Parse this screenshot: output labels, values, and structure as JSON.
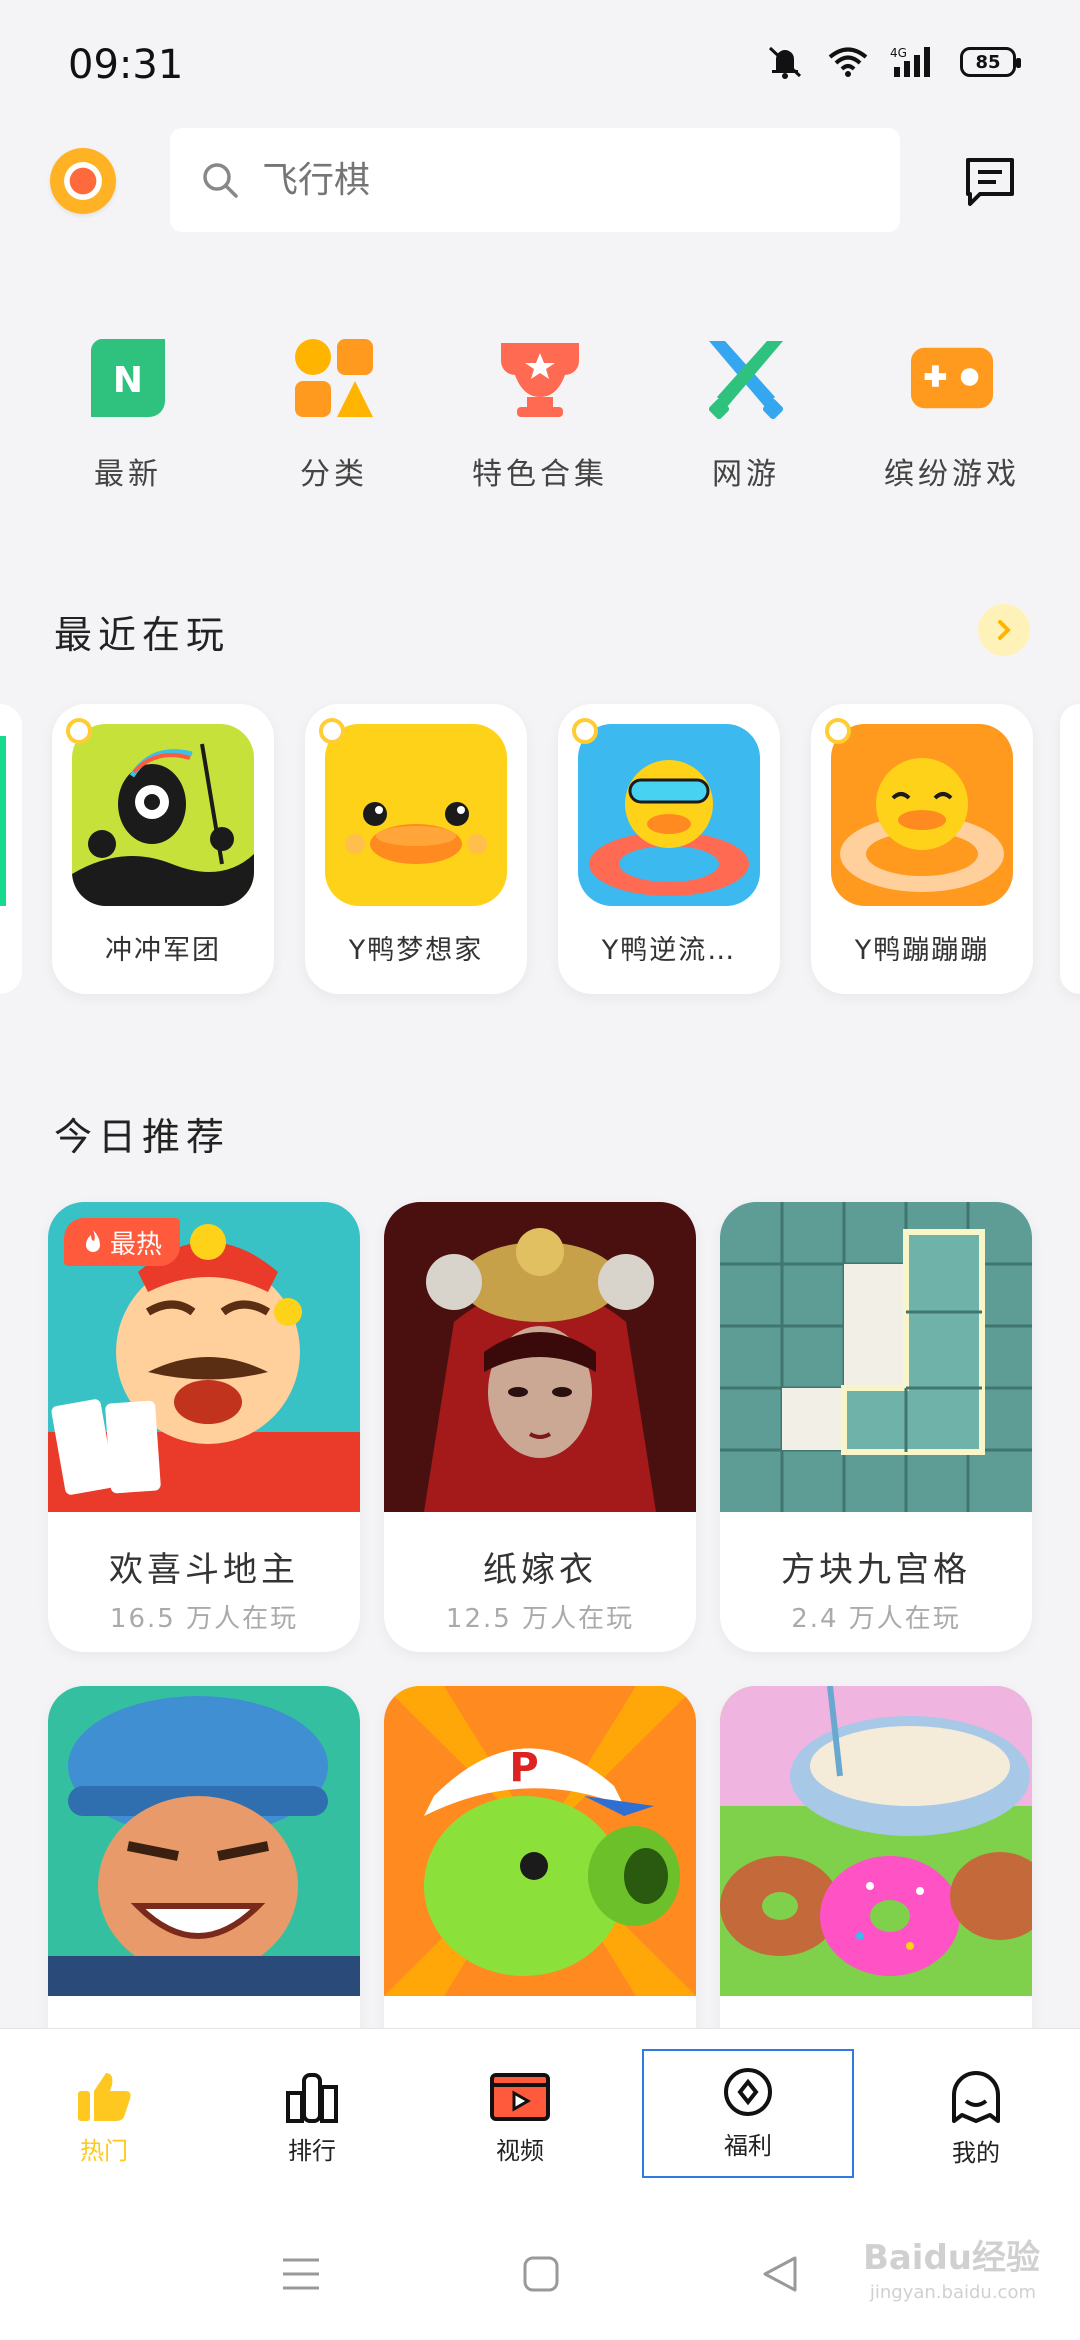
{
  "status_bar": {
    "time": "09:31",
    "battery": "85",
    "network": "4G"
  },
  "search": {
    "placeholder": "飞行棋"
  },
  "categories": [
    {
      "label": "最新",
      "icon": "new-badge-icon",
      "letter": "N"
    },
    {
      "label": "分类",
      "icon": "category-shapes-icon"
    },
    {
      "label": "特色合集",
      "icon": "trophy-icon"
    },
    {
      "label": "网游",
      "icon": "crossed-swords-icon"
    },
    {
      "label": "缤纷游戏",
      "icon": "gamepad-icon"
    }
  ],
  "recent": {
    "title": "最近在玩",
    "items": [
      {
        "name": "冲冲军团"
      },
      {
        "name": "Y鸭梦想家"
      },
      {
        "name": "Y鸭逆流…"
      },
      {
        "name": "Y鸭蹦蹦蹦"
      }
    ]
  },
  "recommend": {
    "title": "今日推荐",
    "hot_tag": "最热",
    "items": [
      {
        "name": "欢喜斗地主",
        "players": "16.5 万人在玩"
      },
      {
        "name": "纸嫁衣",
        "players": "12.5 万人在玩"
      },
      {
        "name": "方块九宫格",
        "players": "2.4 万人在玩"
      },
      {
        "name": "",
        "players": ""
      },
      {
        "name": "",
        "players": ""
      },
      {
        "name": "",
        "players": ""
      }
    ]
  },
  "bottom_nav": [
    {
      "label": "热门",
      "icon": "thumbs-up-icon",
      "active": true
    },
    {
      "label": "排行",
      "icon": "ranking-bars-icon"
    },
    {
      "label": "视频",
      "icon": "video-play-icon"
    },
    {
      "label": "福利",
      "icon": "welfare-diamond-icon"
    },
    {
      "label": "我的",
      "icon": "ghost-profile-icon"
    }
  ],
  "colors": {
    "accent": "#ffc820",
    "hot": "#ff5a3c",
    "background": "#f4f4f6"
  },
  "watermark": {
    "brand": "Baidu经验",
    "domain": "jingyan.baidu.com"
  }
}
